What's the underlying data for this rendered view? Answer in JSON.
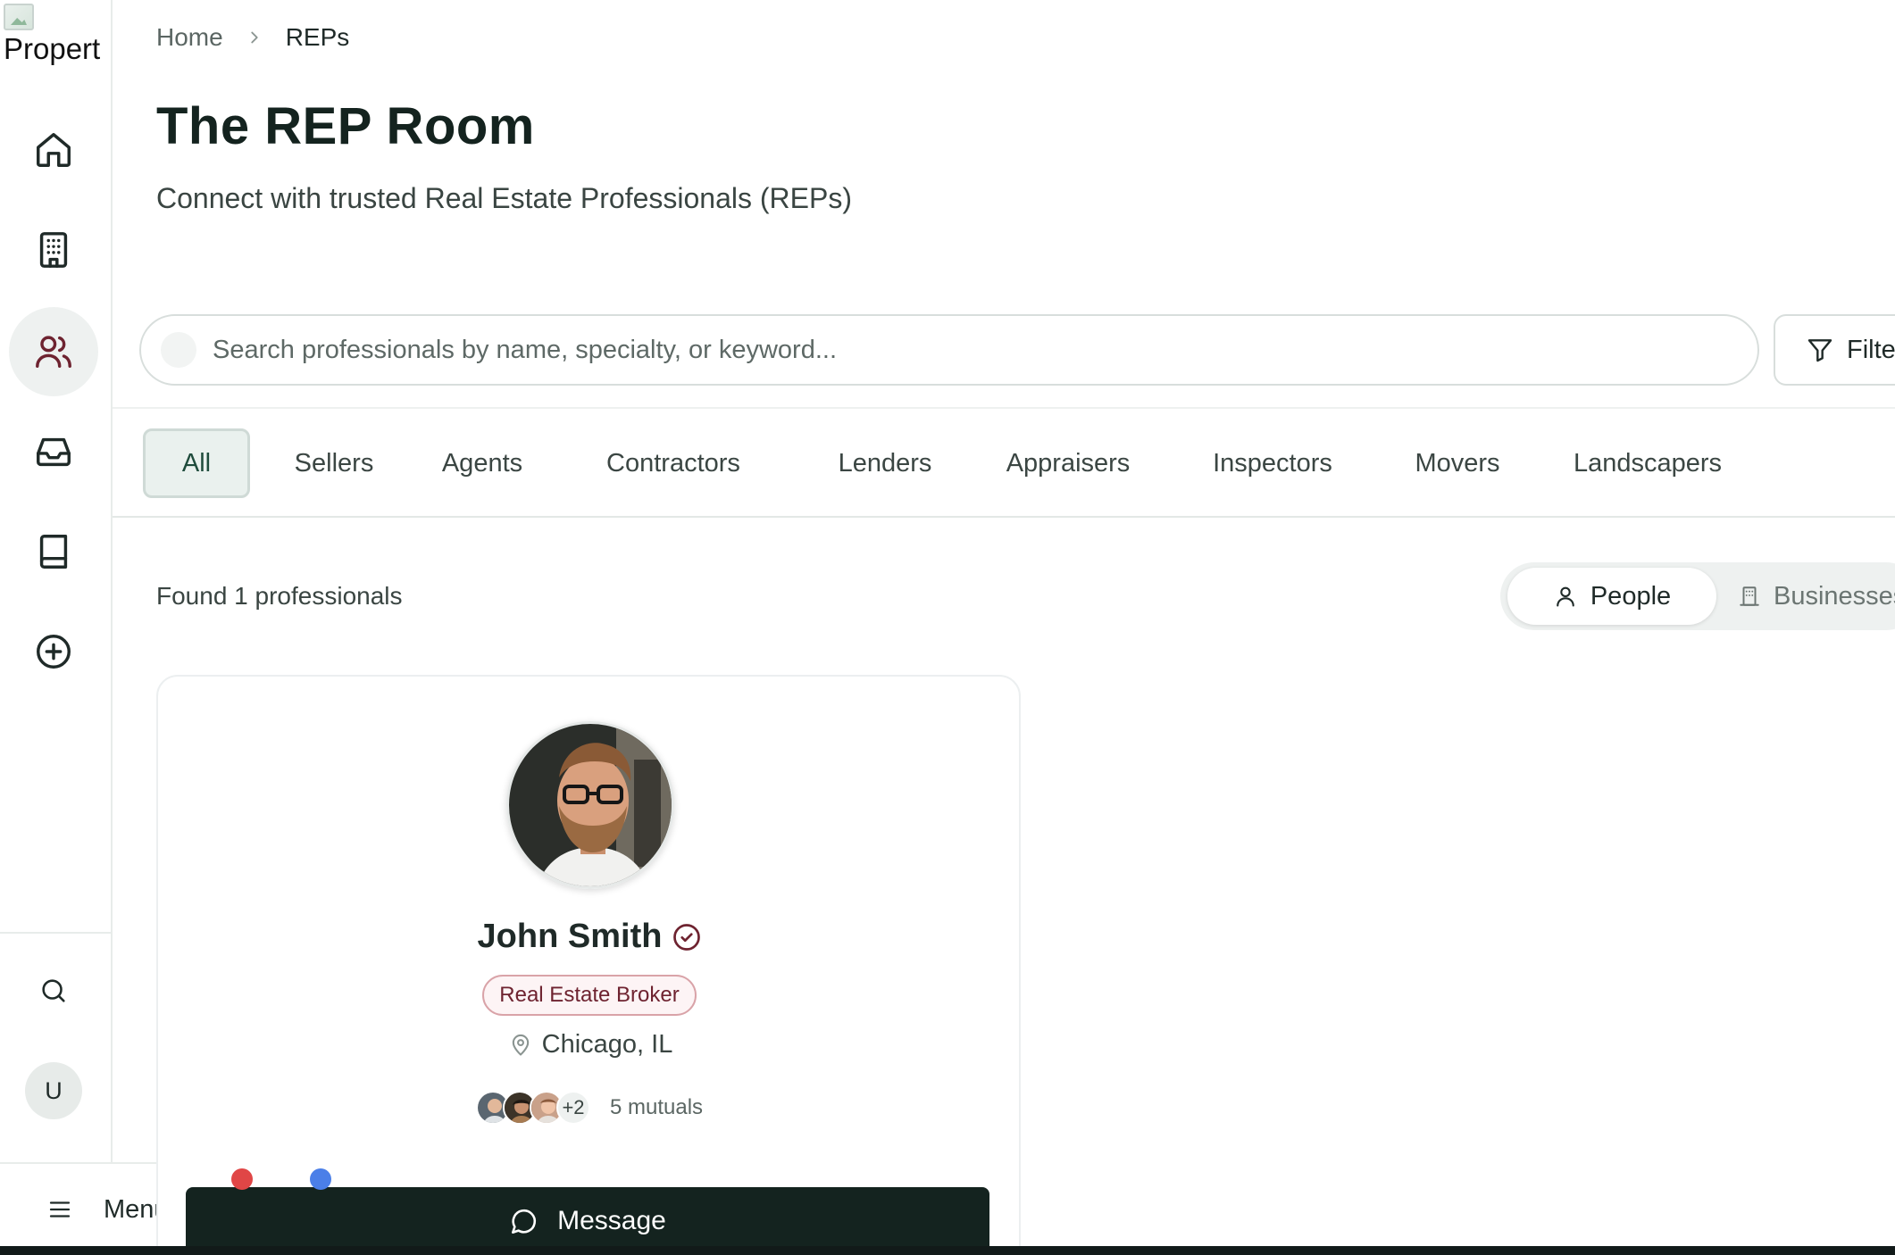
{
  "app": {
    "logo_text": "Propert"
  },
  "sidebar": {
    "items": [
      {
        "icon": "home-icon",
        "active": false
      },
      {
        "icon": "building-icon",
        "active": false
      },
      {
        "icon": "users-icon",
        "active": true
      },
      {
        "icon": "inbox-icon",
        "active": false
      },
      {
        "icon": "book-icon",
        "active": false
      },
      {
        "icon": "plus-circle-icon",
        "active": false
      }
    ],
    "search_icon": "search-icon",
    "avatar_initial": "U",
    "menu_label": "Menu"
  },
  "breadcrumb": {
    "home": "Home",
    "current": "REPs"
  },
  "header": {
    "title": "The REP Room",
    "subtitle": "Connect with trusted Real Estate Professionals (REPs)"
  },
  "search": {
    "placeholder": "Search professionals by name, specialty, or keyword...",
    "value": "",
    "filter_label": "Filte"
  },
  "tabs": [
    {
      "label": "All",
      "active": true
    },
    {
      "label": "Sellers",
      "active": false
    },
    {
      "label": "Agents",
      "active": false
    },
    {
      "label": "Contractors",
      "active": false
    },
    {
      "label": "Lenders",
      "active": false
    },
    {
      "label": "Appraisers",
      "active": false
    },
    {
      "label": "Inspectors",
      "active": false
    },
    {
      "label": "Movers",
      "active": false
    },
    {
      "label": "Landscapers",
      "active": false
    }
  ],
  "results": {
    "found_text": "Found 1 professionals",
    "toggle": {
      "people": "People",
      "businesses": "Businesses",
      "selected": "People"
    }
  },
  "card": {
    "name": "John Smith",
    "verified": true,
    "role": "Real Estate Broker",
    "location": "Chicago, IL",
    "mutuals_more": "+2",
    "mutuals_text": "5 mutuals",
    "message_label": "Message"
  },
  "colors": {
    "brand_dark": "#14231f",
    "accent_maroon": "#6e2330",
    "tab_active_bg": "#eaf1ee"
  }
}
